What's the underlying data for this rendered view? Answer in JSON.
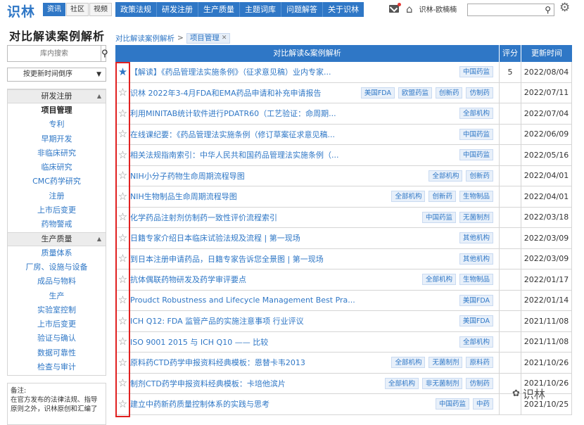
{
  "header": {
    "logo": "识林",
    "mini_tabs": [
      {
        "label": "资讯",
        "active": true
      },
      {
        "label": "社区",
        "active": false
      },
      {
        "label": "视频",
        "active": false
      }
    ],
    "nav": [
      "政策法规",
      "研发注册",
      "生产质量",
      "主题词库",
      "问题解答",
      "关于识林"
    ],
    "username": "识林-欧楠楠",
    "search_placeholder": ""
  },
  "sidebar": {
    "title": "对比解读案例解析",
    "search_placeholder": "库内搜索",
    "sort_label": "按更新时间倒序",
    "groups": [
      {
        "name": "研发注册",
        "items": [
          {
            "label": "项目管理",
            "active": true
          },
          {
            "label": "专利",
            "active": false
          },
          {
            "label": "早期开发",
            "active": false
          },
          {
            "label": "非临床研究",
            "active": false
          },
          {
            "label": "临床研究",
            "active": false
          },
          {
            "label": "CMC药学研究",
            "active": false
          },
          {
            "label": "注册",
            "active": false
          },
          {
            "label": "上市后变更",
            "active": false
          },
          {
            "label": "药物警戒",
            "active": false
          }
        ]
      },
      {
        "name": "生产质量",
        "items": [
          {
            "label": "质量体系",
            "active": false
          },
          {
            "label": "厂房、设施与设备",
            "active": false
          },
          {
            "label": "成品与物料",
            "active": false
          },
          {
            "label": "生产",
            "active": false
          },
          {
            "label": "实验室控制",
            "active": false
          },
          {
            "label": "上市后变更",
            "active": false
          },
          {
            "label": "验证与确认",
            "active": false
          },
          {
            "label": "数据可靠性",
            "active": false
          },
          {
            "label": "检查与审计",
            "active": false
          }
        ]
      }
    ],
    "note": "备注:\n在官方发布的法律法规、指导原则之外，识林原创和汇编了"
  },
  "breadcrumb": {
    "parent": "对比解读案例解析",
    "current": "项目管理"
  },
  "table": {
    "headers": {
      "title": "对比解读&案例解析",
      "score": "评分",
      "date": "更新时间"
    },
    "rows": [
      {
        "starred": true,
        "title": "【解读】《药品管理法实施条例》（征求意见稿）业内专家...",
        "tags": [
          "中国药监"
        ],
        "score": "5",
        "date": "2022/08/04"
      },
      {
        "starred": false,
        "title": "识林 2022年3-4月FDA和EMA药品申请和补充申请报告",
        "tags": [
          "美国FDA",
          "欧盟药监",
          "创新药",
          "仿制药"
        ],
        "score": "",
        "date": "2022/07/11"
      },
      {
        "starred": false,
        "title": "利用MINITAB统计软件进行PDATR60（工艺验证：命周期...",
        "tags": [
          "全部机构"
        ],
        "score": "",
        "date": "2022/07/04"
      },
      {
        "starred": false,
        "title": "在线课纪要：《药品管理法实施条例（修订草案征求意见稿...",
        "tags": [
          "中国药监"
        ],
        "score": "",
        "date": "2022/06/09"
      },
      {
        "starred": false,
        "title": "相关法规指南索引：中华人民共和国药品管理法实施条例（...",
        "tags": [
          "中国药监"
        ],
        "score": "",
        "date": "2022/05/16"
      },
      {
        "starred": false,
        "title": "NIH小分子药物生命周期流程导图",
        "tags": [
          "全部机构",
          "创新药"
        ],
        "score": "",
        "date": "2022/04/01"
      },
      {
        "starred": false,
        "title": "NIH生物制品生命周期流程导图",
        "tags": [
          "全部机构",
          "创新药",
          "生物制品"
        ],
        "score": "",
        "date": "2022/04/01"
      },
      {
        "starred": false,
        "title": "化学药品注射剂仿制药一致性评价流程索引",
        "tags": [
          "中国药监",
          "无菌制剂"
        ],
        "score": "",
        "date": "2022/03/18"
      },
      {
        "starred": false,
        "title": "日籍专家介绍日本临床试验法规及流程 | 第一现场",
        "tags": [
          "其他机构"
        ],
        "score": "",
        "date": "2022/03/09"
      },
      {
        "starred": false,
        "title": "到日本注册申请药品，日籍专家告诉您全景图 | 第一现场",
        "tags": [
          "其他机构"
        ],
        "score": "",
        "date": "2022/03/09"
      },
      {
        "starred": false,
        "title": "抗体偶联药物研发及药学审评要点",
        "tags": [
          "全部机构",
          "生物制品"
        ],
        "score": "",
        "date": "2022/01/17"
      },
      {
        "starred": false,
        "title": "Proudct Robustness and Lifecycle Management Best Pra...",
        "tags": [
          "美国FDA"
        ],
        "score": "",
        "date": "2022/01/14"
      },
      {
        "starred": false,
        "title": "ICH Q12: FDA 监管产品的实施注意事项 行业评议",
        "tags": [
          "美国FDA"
        ],
        "score": "",
        "date": "2021/11/08"
      },
      {
        "starred": false,
        "title": "ISO 9001 2015 与 ICH Q10 —— 比较",
        "tags": [
          "全部机构"
        ],
        "score": "",
        "date": "2021/11/08"
      },
      {
        "starred": false,
        "title": "原料药CTD药学申报资料经典模板：恩替卡韦2013",
        "tags": [
          "全部机构",
          "无菌制剂",
          "原料药"
        ],
        "score": "",
        "date": "2021/10/26"
      },
      {
        "starred": false,
        "title": "制剂CTD药学申报资料经典模板：卡培他滨片",
        "tags": [
          "全部机构",
          "非无菌制剂",
          "仿制药"
        ],
        "score": "",
        "date": "2021/10/26"
      },
      {
        "starred": false,
        "title": "建立中药新药质量控制体系的实践与思考",
        "tags": [
          "中国药监",
          "中药"
        ],
        "score": "",
        "date": "2021/10/25"
      }
    ]
  },
  "watermark": "识林",
  "icons": {
    "mail": "mail-icon",
    "home": "home-icon",
    "search": "search-icon",
    "settings": "gear-icon",
    "star": "star-icon"
  },
  "colors": {
    "brand": "#2f77c6",
    "highlight_frame": "#e02020",
    "tag_bg": "#e8f0fa"
  }
}
